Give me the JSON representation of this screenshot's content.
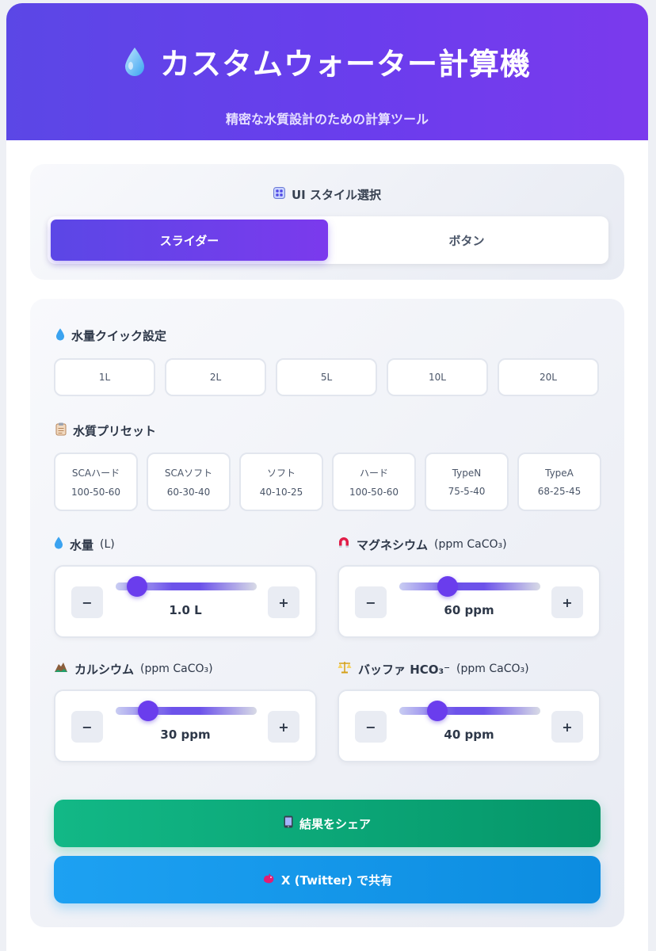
{
  "header": {
    "title": "カスタムウォーター計算機",
    "subtitle": "精密な水質設計のための計算ツール",
    "icon": "water-drop-icon"
  },
  "ui_style": {
    "title": "UI スタイル選択",
    "icon": "control-knobs-icon",
    "options": [
      "スライダー",
      "ボタン"
    ],
    "selected": "スライダー"
  },
  "quick_volume": {
    "title": "水量クイック設定",
    "icon": "water-drop-icon",
    "buttons": [
      "1L",
      "2L",
      "5L",
      "10L",
      "20L"
    ]
  },
  "presets": {
    "title": "水質プリセット",
    "icon": "clipboard-icon",
    "items": [
      {
        "name": "SCAハード",
        "value": "100-50-60"
      },
      {
        "name": "SCAソフト",
        "value": "60-30-40"
      },
      {
        "name": "ソフト",
        "value": "40-10-25"
      },
      {
        "name": "ハード",
        "value": "100-50-60"
      },
      {
        "name": "TypeN",
        "value": "75-5-40"
      },
      {
        "name": "TypeA",
        "value": "68-25-45"
      }
    ]
  },
  "params": {
    "volume": {
      "label": "水量",
      "unit": "(L)",
      "value": "1.0 L",
      "level": 0.15,
      "icon": "water-drop-icon"
    },
    "magnesium": {
      "label": "マグネシウム",
      "unit": "(ppm CaCO₃)",
      "value": "60 ppm",
      "level": 0.34,
      "icon": "magnet-icon"
    },
    "calcium": {
      "label": "カルシウム",
      "unit": "(ppm CaCO₃)",
      "value": "30 ppm",
      "level": 0.23,
      "icon": "rock-icon"
    },
    "buffer": {
      "label": "バッファ HCO₃⁻",
      "unit": "(ppm CaCO₃)",
      "value": "40 ppm",
      "level": 0.27,
      "icon": "balance-scale-icon"
    }
  },
  "stepper": {
    "minus": "−",
    "plus": "+"
  },
  "share": {
    "result_label": "結果をシェア",
    "result_icon": "mobile-phone-icon",
    "twitter_label": "X (Twitter) で共有",
    "twitter_icon": "bird-icon"
  },
  "colors": {
    "accent": "#6a3ded",
    "green": "#10b981",
    "blue": "#1da1f2"
  }
}
